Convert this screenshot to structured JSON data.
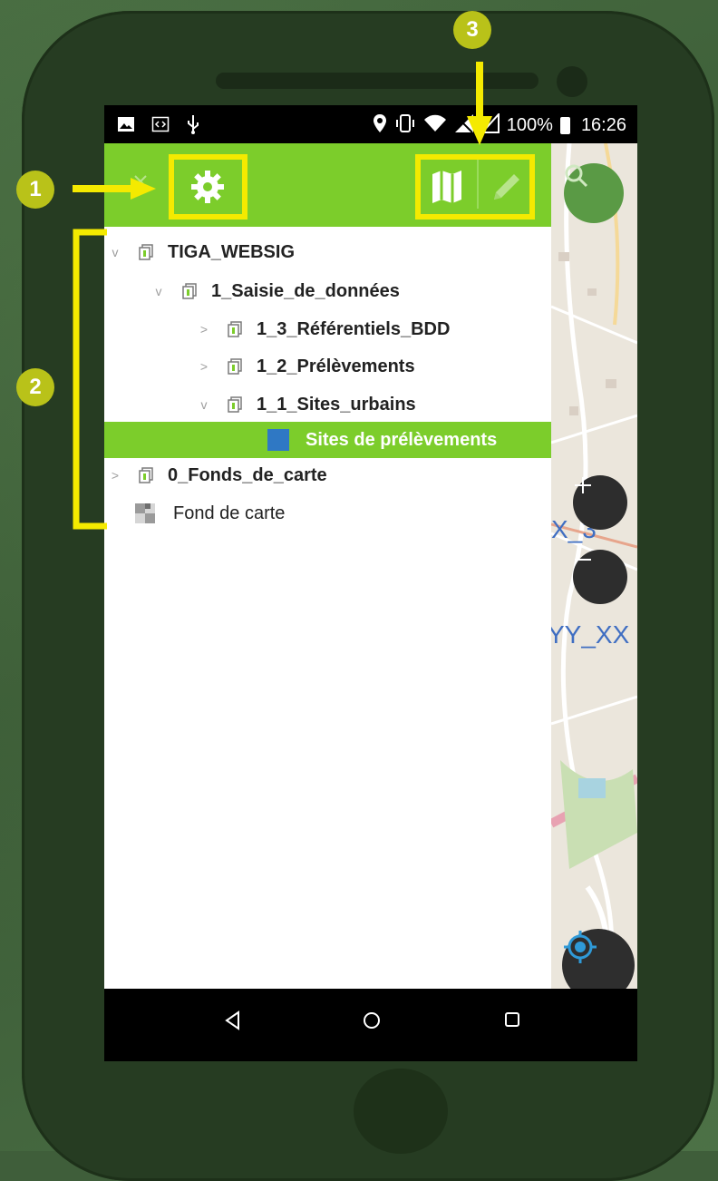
{
  "status_bar": {
    "battery": "100%",
    "time": "16:26"
  },
  "layer_tree": [
    {
      "label": "TIGA_WEBSIG",
      "expander": "v",
      "bold": true,
      "selected": false,
      "icon": "layer-group-icon"
    },
    {
      "label": "1_Saisie_de_données",
      "expander": "v",
      "bold": true,
      "selected": false,
      "icon": "layer-group-icon"
    },
    {
      "label": "1_3_Référentiels_BDD",
      "expander": ">",
      "bold": true,
      "selected": false,
      "icon": "layer-group-icon"
    },
    {
      "label": "1_2_Prélèvements",
      "expander": ">",
      "bold": true,
      "selected": false,
      "icon": "layer-group-icon"
    },
    {
      "label": "1_1_Sites_urbains",
      "expander": "v",
      "bold": true,
      "selected": false,
      "icon": "layer-group-icon"
    },
    {
      "label": "Sites de prélèvements",
      "expander": "",
      "bold": true,
      "selected": true,
      "icon": "layer-symbol-square"
    },
    {
      "label": "0_Fonds_de_carte",
      "expander": ">",
      "bold": true,
      "selected": false,
      "icon": "layer-group-icon"
    },
    {
      "label": "Fond de carte",
      "expander": "",
      "bold": false,
      "selected": false,
      "icon": "raster-layer-icon"
    }
  ],
  "map": {
    "label_1": "X_3",
    "label_2": "YY_XX"
  },
  "annotations": {
    "badge_1": "1",
    "badge_2": "2",
    "badge_3": "3"
  },
  "colors": {
    "accent_green": "#7ccd2b",
    "highlight_yellow": "#f4ea00",
    "badge_olive": "#b9c219",
    "layer_symbol_blue": "#2f78c4"
  }
}
